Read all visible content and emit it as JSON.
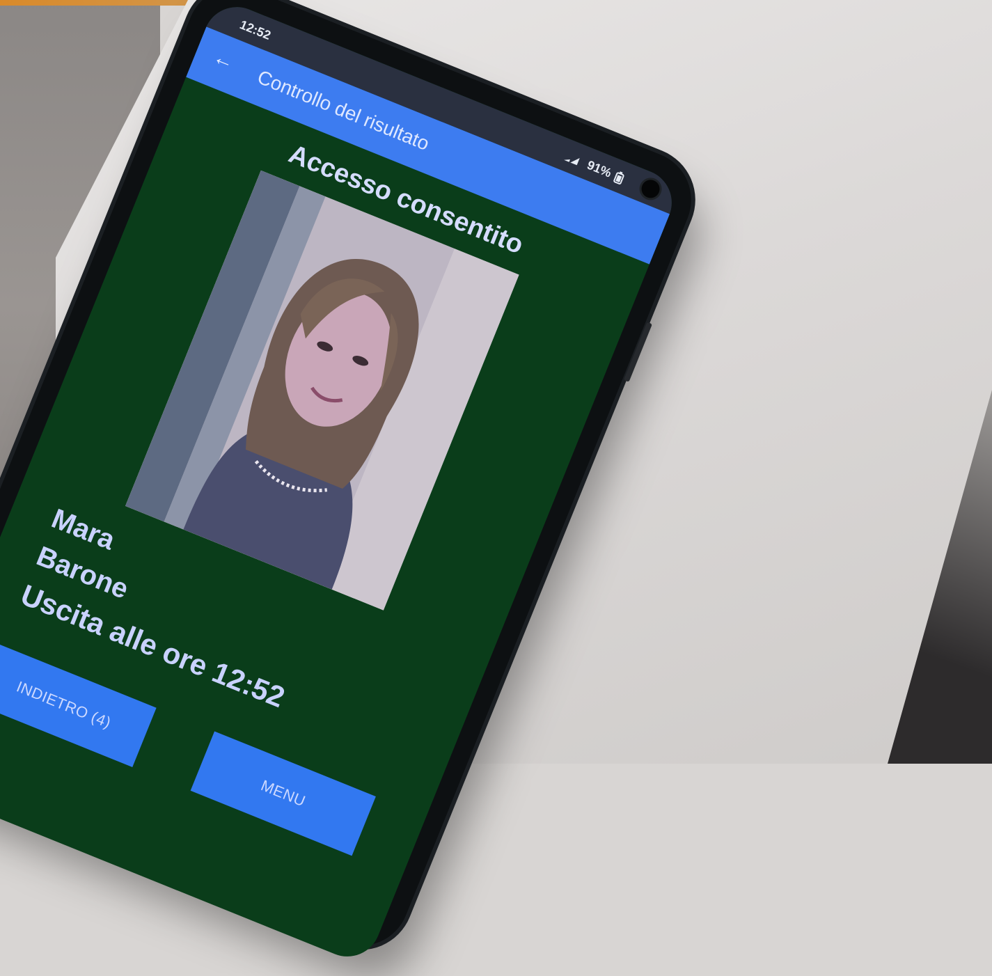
{
  "status_bar": {
    "time": "12:52",
    "battery": "91%"
  },
  "app_bar": {
    "title": "Controllo del risultato",
    "back_icon": "arrow-left-icon"
  },
  "result": {
    "headline": "Accesso consentito",
    "first_name": "Mara",
    "last_name": "Barone",
    "exit_text": "Uscita alle ore 12:52"
  },
  "buttons": {
    "back_label": "INDIETRO (4)",
    "menu_label": "MENU"
  },
  "colors": {
    "screen_background": "#0a3d1a",
    "app_bar": "#3d7cf0",
    "button": "#3278f0"
  }
}
